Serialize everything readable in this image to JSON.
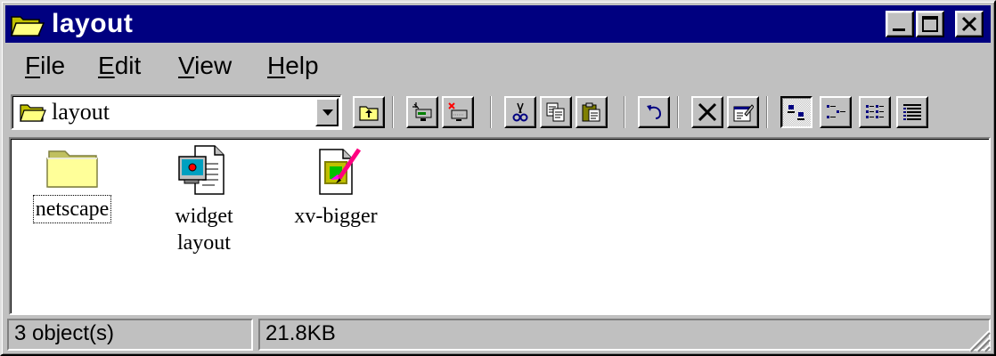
{
  "window": {
    "title": "layout",
    "title_icon": "folder-open-icon",
    "title_bar_color": "#000080",
    "controls": [
      {
        "name": "minimize-icon"
      },
      {
        "name": "maximize-icon"
      },
      {
        "name": "close-icon"
      }
    ]
  },
  "menu": {
    "items": [
      {
        "label": "ile",
        "mnemonic": "F"
      },
      {
        "label": "dit",
        "mnemonic": "E"
      },
      {
        "label": "iew",
        "mnemonic": "V"
      },
      {
        "label": "elp",
        "mnemonic": "H"
      }
    ]
  },
  "toolbar": {
    "address_value": "layout",
    "address_icon": "folder-open-icon",
    "buttons": [
      {
        "name": "up-one-level-icon"
      },
      {
        "name": "map-network-drive-icon"
      },
      {
        "name": "disconnect-network-drive-icon"
      },
      {
        "name": "cut-icon"
      },
      {
        "name": "copy-icon"
      },
      {
        "name": "paste-icon"
      },
      {
        "name": "undo-icon"
      },
      {
        "name": "delete-icon"
      },
      {
        "name": "properties-icon"
      },
      {
        "name": "large-icons-icon",
        "pressed": true
      },
      {
        "name": "small-icons-icon"
      },
      {
        "name": "list-icon"
      },
      {
        "name": "details-icon"
      }
    ]
  },
  "files": [
    {
      "name": "netscape",
      "icon": "folder-icon",
      "focused": true
    },
    {
      "name": "widget\nlayout",
      "icon": "document-icon"
    },
    {
      "name": "xv-bigger",
      "icon": "image-file-icon"
    }
  ],
  "status": {
    "objects": "3 object(s)",
    "size": "21.8KB"
  }
}
